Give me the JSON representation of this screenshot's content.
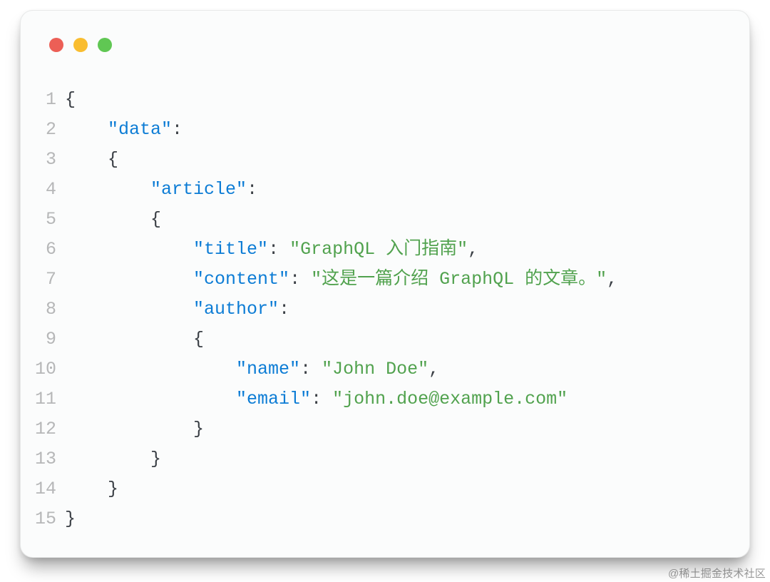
{
  "window": {
    "traffic_colors": {
      "red": "#ec5f56",
      "yellow": "#f9bd30",
      "green": "#60c753"
    }
  },
  "watermark": "@稀土掘金技术社区",
  "lines": [
    {
      "num": "1",
      "tokens": [
        {
          "t": "{",
          "c": "plain"
        }
      ]
    },
    {
      "num": "2",
      "tokens": [
        {
          "t": "    ",
          "c": "plain"
        },
        {
          "t": "\"data\"",
          "c": "key"
        },
        {
          "t": ":",
          "c": "plain"
        }
      ]
    },
    {
      "num": "3",
      "tokens": [
        {
          "t": "    {",
          "c": "plain"
        }
      ]
    },
    {
      "num": "4",
      "tokens": [
        {
          "t": "        ",
          "c": "plain"
        },
        {
          "t": "\"article\"",
          "c": "key"
        },
        {
          "t": ":",
          "c": "plain"
        }
      ]
    },
    {
      "num": "5",
      "tokens": [
        {
          "t": "        {",
          "c": "plain"
        }
      ]
    },
    {
      "num": "6",
      "tokens": [
        {
          "t": "            ",
          "c": "plain"
        },
        {
          "t": "\"title\"",
          "c": "key"
        },
        {
          "t": ": ",
          "c": "plain"
        },
        {
          "t": "\"GraphQL 入门指南\"",
          "c": "string"
        },
        {
          "t": ",",
          "c": "plain"
        }
      ]
    },
    {
      "num": "7",
      "tokens": [
        {
          "t": "            ",
          "c": "plain"
        },
        {
          "t": "\"content\"",
          "c": "key"
        },
        {
          "t": ": ",
          "c": "plain"
        },
        {
          "t": "\"这是一篇介绍 GraphQL 的文章。\"",
          "c": "string"
        },
        {
          "t": ",",
          "c": "plain"
        }
      ]
    },
    {
      "num": "8",
      "tokens": [
        {
          "t": "            ",
          "c": "plain"
        },
        {
          "t": "\"author\"",
          "c": "key"
        },
        {
          "t": ":",
          "c": "plain"
        }
      ]
    },
    {
      "num": "9",
      "tokens": [
        {
          "t": "            {",
          "c": "plain"
        }
      ]
    },
    {
      "num": "10",
      "tokens": [
        {
          "t": "                ",
          "c": "plain"
        },
        {
          "t": "\"name\"",
          "c": "key"
        },
        {
          "t": ": ",
          "c": "plain"
        },
        {
          "t": "\"John Doe\"",
          "c": "string"
        },
        {
          "t": ",",
          "c": "plain"
        }
      ]
    },
    {
      "num": "11",
      "tokens": [
        {
          "t": "                ",
          "c": "plain"
        },
        {
          "t": "\"email\"",
          "c": "key"
        },
        {
          "t": ": ",
          "c": "plain"
        },
        {
          "t": "\"john.doe@example.com\"",
          "c": "string"
        }
      ]
    },
    {
      "num": "12",
      "tokens": [
        {
          "t": "            }",
          "c": "plain"
        }
      ]
    },
    {
      "num": "13",
      "tokens": [
        {
          "t": "        }",
          "c": "plain"
        }
      ]
    },
    {
      "num": "14",
      "tokens": [
        {
          "t": "    }",
          "c": "plain"
        }
      ]
    },
    {
      "num": "15",
      "tokens": [
        {
          "t": "}",
          "c": "plain"
        }
      ]
    }
  ]
}
